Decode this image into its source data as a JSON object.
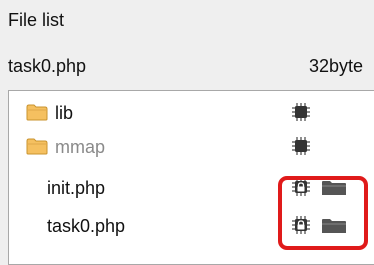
{
  "header": {
    "title": "File list"
  },
  "selected_file": {
    "name": "task0.php",
    "size": "32byte"
  },
  "files": [
    {
      "label": "lib",
      "type": "folder",
      "dim": false,
      "icons": [
        "chip-icon"
      ]
    },
    {
      "label": "mmap",
      "type": "folder",
      "dim": true,
      "icons": [
        "chip-icon"
      ]
    },
    {
      "label": "init.php",
      "type": "file",
      "dim": false,
      "icons": [
        "chip-lock-icon",
        "folder-icon"
      ]
    },
    {
      "label": "task0.php",
      "type": "file",
      "dim": false,
      "icons": [
        "chip-lock-icon",
        "folder-icon"
      ]
    }
  ],
  "colors": {
    "folder": "#f5c060",
    "chip": "#444444",
    "action_folder": "#555555",
    "highlight": "#e01a1a"
  }
}
